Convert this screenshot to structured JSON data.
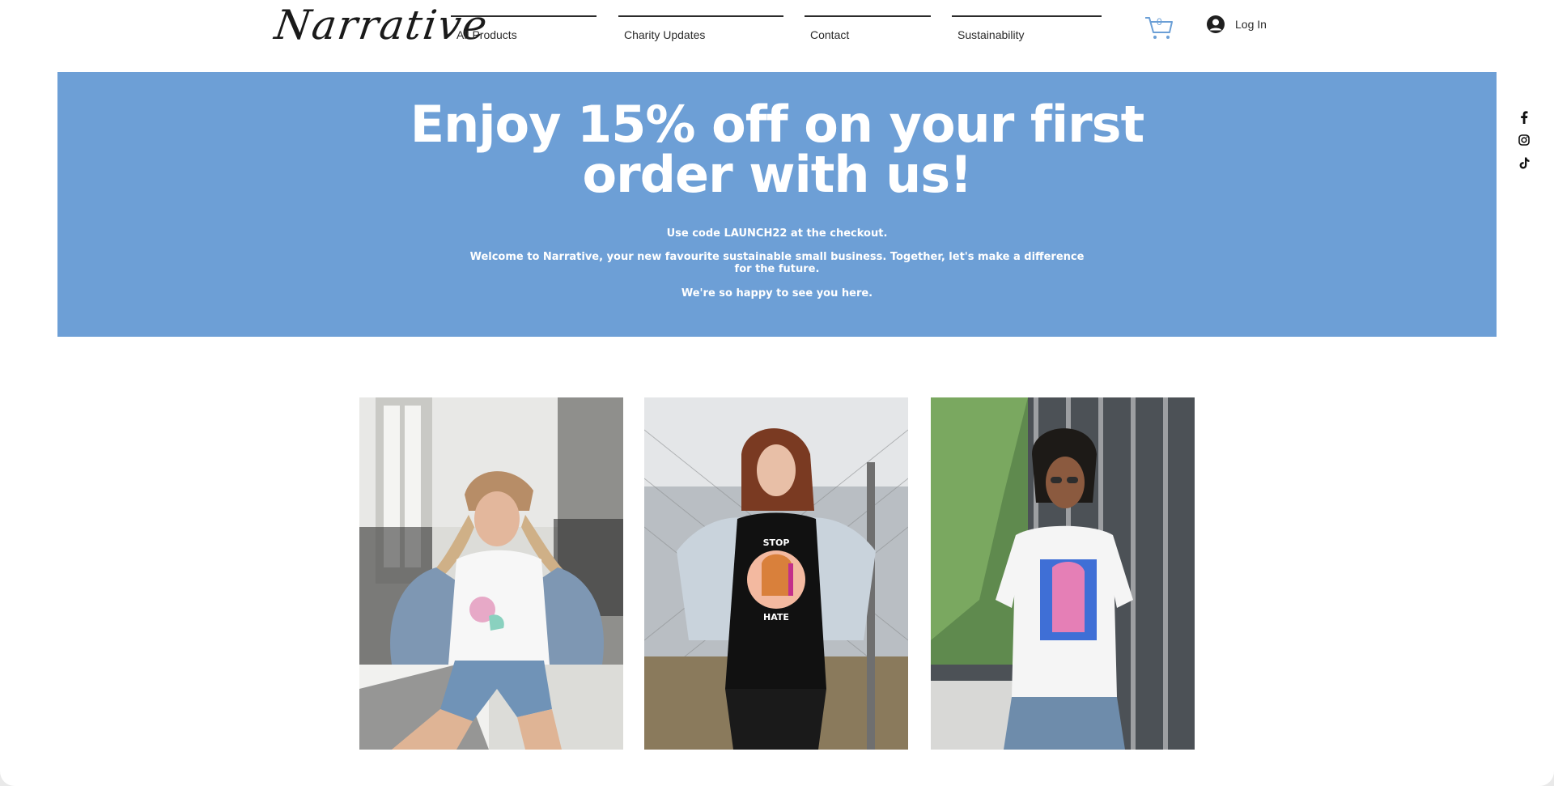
{
  "brand": {
    "logo_text": "Narrative"
  },
  "nav": {
    "items": [
      {
        "label": "All Products"
      },
      {
        "label": "Charity Updates"
      },
      {
        "label": "Contact"
      },
      {
        "label": "Sustainability"
      }
    ]
  },
  "cart": {
    "count": "0",
    "icon": "cart-icon",
    "color": "#6b9fd6"
  },
  "account": {
    "login_label": "Log In",
    "icon": "user-avatar-icon"
  },
  "banner": {
    "headline_line1": "Enjoy 15% off on your first",
    "headline_line2": "order with us!",
    "code_text": "Use code LAUNCH22 at the checkout.",
    "welcome_text": "Welcome to Narrative, your new favourite sustainable small business. Together, let's make a difference for the future.",
    "happy_text": "We're so happy to see you here.",
    "background_color": "#6d9fd6"
  },
  "social": {
    "icons": [
      "facebook-icon",
      "instagram-icon",
      "tiktok-icon"
    ]
  },
  "gallery": {
    "images": [
      {
        "name": "model-rose-tee-photo"
      },
      {
        "name": "model-stop-hate-tee-photo"
      },
      {
        "name": "model-stop-asian-hate-tee-photo"
      }
    ],
    "tee_print_text": {
      "top": "STOP",
      "bottom": "HATE"
    }
  }
}
